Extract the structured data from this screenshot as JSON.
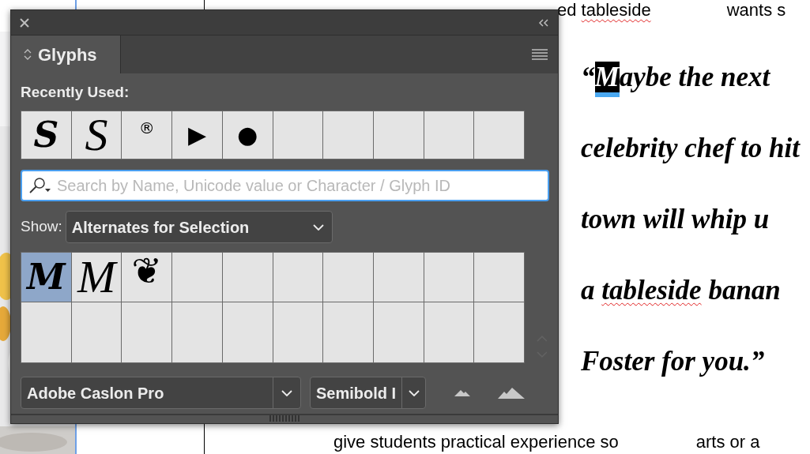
{
  "document": {
    "top_line": [
      {
        "segments": [
          {
            "text": "ed ",
            "misspelled": false
          },
          {
            "text": "tableside",
            "misspelled": true
          }
        ]
      },
      {
        "segments": [
          {
            "text": "wants s",
            "misspelled": false
          }
        ]
      }
    ],
    "quote_lines": [
      [
        {
          "text": "“",
          "selected": false,
          "misspelled": false
        },
        {
          "text": "M",
          "selected": true,
          "misspelled": false
        },
        {
          "text": "aybe the next",
          "selected": false,
          "misspelled": false
        }
      ],
      [
        {
          "text": "celebrity chef to hit",
          "selected": false,
          "misspelled": false
        }
      ],
      [
        {
          "text": "town will whip u",
          "selected": false,
          "misspelled": false
        }
      ],
      [
        {
          "text": "a ",
          "selected": false,
          "misspelled": false
        },
        {
          "text": "tableside",
          "selected": false,
          "misspelled": true
        },
        {
          "text": " banan",
          "selected": false,
          "misspelled": false
        }
      ],
      [
        {
          "text": "Foster for you.”",
          "selected": false,
          "misspelled": false
        }
      ]
    ],
    "bottom_line": [
      {
        "segments": [
          {
            "text": "give students practical experience so",
            "misspelled": false
          }
        ]
      },
      {
        "segments": [
          {
            "text": "arts or a",
            "misspelled": false
          }
        ]
      }
    ]
  },
  "panel": {
    "title": "Glyphs",
    "recently_used": {
      "label": "Recently Used:",
      "glyphs": [
        {
          "kind": "italic",
          "char": "S"
        },
        {
          "kind": "swash",
          "char": "S"
        },
        {
          "kind": "small",
          "char": "®"
        },
        {
          "kind": "plain",
          "char": "▶"
        },
        {
          "kind": "plain",
          "char": "●"
        },
        {
          "kind": "empty"
        },
        {
          "kind": "empty"
        },
        {
          "kind": "empty"
        },
        {
          "kind": "empty"
        },
        {
          "kind": "empty"
        }
      ]
    },
    "search": {
      "placeholder": "Search by Name, Unicode value or Character / Glyph ID"
    },
    "show": {
      "label": "Show:",
      "value": "Alternates for Selection"
    },
    "alternates": [
      {
        "kind": "italic",
        "char": "M",
        "selected": true
      },
      {
        "kind": "swash",
        "char": "M",
        "selected": false
      },
      {
        "kind": "ornament",
        "char": "❦",
        "selected": false
      },
      {
        "kind": "empty",
        "selected": false
      },
      {
        "kind": "empty",
        "selected": false
      },
      {
        "kind": "empty",
        "selected": false
      },
      {
        "kind": "empty",
        "selected": false
      },
      {
        "kind": "empty",
        "selected": false
      },
      {
        "kind": "empty",
        "selected": false
      },
      {
        "kind": "empty",
        "selected": false
      },
      {
        "kind": "empty",
        "selected": false
      },
      {
        "kind": "empty",
        "selected": false
      },
      {
        "kind": "empty",
        "selected": false
      },
      {
        "kind": "empty",
        "selected": false
      },
      {
        "kind": "empty",
        "selected": false
      },
      {
        "kind": "empty",
        "selected": false
      },
      {
        "kind": "empty",
        "selected": false
      },
      {
        "kind": "empty",
        "selected": false
      },
      {
        "kind": "empty",
        "selected": false
      },
      {
        "kind": "empty",
        "selected": false
      }
    ],
    "font_family": "Adobe Caslon Pro",
    "font_style": "Semibold I"
  }
}
